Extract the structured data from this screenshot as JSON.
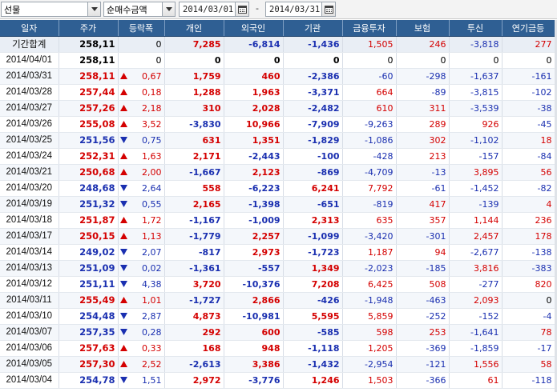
{
  "toolbar": {
    "market_select": "선물",
    "type_select": "순매수금액",
    "start_date": "2014/03/01",
    "separator": "-",
    "end_date": "2014/03/31"
  },
  "colors": {
    "up": "#d40000",
    "down": "#1a2fb0",
    "header_bg": "#2f5f93"
  },
  "table": {
    "headers": [
      "일자",
      "주가",
      "등락폭",
      "개인",
      "외국인",
      "기관",
      "금융투자",
      "보험",
      "투신",
      "연기금등"
    ],
    "summary": {
      "label": "기간합계",
      "price": "258,11",
      "change": "0",
      "individual": "7,285",
      "foreign": "-6,814",
      "institution": "-1,436",
      "fin_invest": "1,505",
      "insurance": "246",
      "trust": "-3,818",
      "pension": "277"
    },
    "rows": [
      {
        "date": "2014/04/01",
        "price": "258,11",
        "dir": "none",
        "change": "0",
        "individual": "0",
        "foreign": "0",
        "institution": "0",
        "fin_invest": "0",
        "insurance": "0",
        "trust": "0",
        "pension": "0"
      },
      {
        "date": "2014/03/31",
        "price": "258,11",
        "dir": "up",
        "change": "0,67",
        "individual": "1,759",
        "foreign": "460",
        "institution": "-2,386",
        "fin_invest": "-60",
        "insurance": "-298",
        "trust": "-1,637",
        "pension": "-161"
      },
      {
        "date": "2014/03/28",
        "price": "257,44",
        "dir": "up",
        "change": "0,18",
        "individual": "1,288",
        "foreign": "1,963",
        "institution": "-3,371",
        "fin_invest": "664",
        "insurance": "-89",
        "trust": "-3,815",
        "pension": "-102"
      },
      {
        "date": "2014/03/27",
        "price": "257,26",
        "dir": "up",
        "change": "2,18",
        "individual": "310",
        "foreign": "2,028",
        "institution": "-2,482",
        "fin_invest": "610",
        "insurance": "311",
        "trust": "-3,539",
        "pension": "-38"
      },
      {
        "date": "2014/03/26",
        "price": "255,08",
        "dir": "up",
        "change": "3,52",
        "individual": "-3,830",
        "foreign": "10,966",
        "institution": "-7,909",
        "fin_invest": "-9,263",
        "insurance": "289",
        "trust": "926",
        "pension": "-45"
      },
      {
        "date": "2014/03/25",
        "price": "251,56",
        "dir": "down",
        "change": "0,75",
        "individual": "631",
        "foreign": "1,351",
        "institution": "-1,829",
        "fin_invest": "-1,086",
        "insurance": "302",
        "trust": "-1,102",
        "pension": "18"
      },
      {
        "date": "2014/03/24",
        "price": "252,31",
        "dir": "up",
        "change": "1,63",
        "individual": "2,171",
        "foreign": "-2,443",
        "institution": "-100",
        "fin_invest": "-428",
        "insurance": "213",
        "trust": "-157",
        "pension": "-84"
      },
      {
        "date": "2014/03/21",
        "price": "250,68",
        "dir": "up",
        "change": "2,00",
        "individual": "-1,667",
        "foreign": "2,123",
        "institution": "-869",
        "fin_invest": "-4,709",
        "insurance": "-13",
        "trust": "3,895",
        "pension": "56"
      },
      {
        "date": "2014/03/20",
        "price": "248,68",
        "dir": "down",
        "change": "2,64",
        "individual": "558",
        "foreign": "-6,223",
        "institution": "6,241",
        "fin_invest": "7,792",
        "insurance": "-61",
        "trust": "-1,452",
        "pension": "-82"
      },
      {
        "date": "2014/03/19",
        "price": "251,32",
        "dir": "down",
        "change": "0,55",
        "individual": "2,165",
        "foreign": "-1,398",
        "institution": "-651",
        "fin_invest": "-819",
        "insurance": "417",
        "trust": "-139",
        "pension": "4"
      },
      {
        "date": "2014/03/18",
        "price": "251,87",
        "dir": "up",
        "change": "1,72",
        "individual": "-1,167",
        "foreign": "-1,009",
        "institution": "2,313",
        "fin_invest": "635",
        "insurance": "357",
        "trust": "1,144",
        "pension": "236"
      },
      {
        "date": "2014/03/17",
        "price": "250,15",
        "dir": "up",
        "change": "1,13",
        "individual": "-1,779",
        "foreign": "2,257",
        "institution": "-1,099",
        "fin_invest": "-3,420",
        "insurance": "-301",
        "trust": "2,457",
        "pension": "178"
      },
      {
        "date": "2014/03/14",
        "price": "249,02",
        "dir": "down",
        "change": "2,07",
        "individual": "-817",
        "foreign": "2,973",
        "institution": "-1,723",
        "fin_invest": "1,187",
        "insurance": "94",
        "trust": "-2,677",
        "pension": "-138"
      },
      {
        "date": "2014/03/13",
        "price": "251,09",
        "dir": "down",
        "change": "0,02",
        "individual": "-1,361",
        "foreign": "-557",
        "institution": "1,349",
        "fin_invest": "-2,023",
        "insurance": "-185",
        "trust": "3,816",
        "pension": "-383"
      },
      {
        "date": "2014/03/12",
        "price": "251,11",
        "dir": "down",
        "change": "4,38",
        "individual": "3,720",
        "foreign": "-10,376",
        "institution": "7,208",
        "fin_invest": "6,425",
        "insurance": "508",
        "trust": "-277",
        "pension": "820"
      },
      {
        "date": "2014/03/11",
        "price": "255,49",
        "dir": "up",
        "change": "1,01",
        "individual": "-1,727",
        "foreign": "2,866",
        "institution": "-426",
        "fin_invest": "-1,948",
        "insurance": "-463",
        "trust": "2,093",
        "pension": "0"
      },
      {
        "date": "2014/03/10",
        "price": "254,48",
        "dir": "down",
        "change": "2,87",
        "individual": "4,873",
        "foreign": "-10,981",
        "institution": "5,595",
        "fin_invest": "5,859",
        "insurance": "-252",
        "trust": "-152",
        "pension": "-4"
      },
      {
        "date": "2014/03/07",
        "price": "257,35",
        "dir": "down",
        "change": "0,28",
        "individual": "292",
        "foreign": "600",
        "institution": "-585",
        "fin_invest": "598",
        "insurance": "253",
        "trust": "-1,641",
        "pension": "78"
      },
      {
        "date": "2014/03/06",
        "price": "257,63",
        "dir": "up",
        "change": "0,33",
        "individual": "168",
        "foreign": "948",
        "institution": "-1,118",
        "fin_invest": "1,205",
        "insurance": "-369",
        "trust": "-1,859",
        "pension": "-17"
      },
      {
        "date": "2014/03/05",
        "price": "257,30",
        "dir": "up",
        "change": "2,52",
        "individual": "-2,613",
        "foreign": "3,386",
        "institution": "-1,432",
        "fin_invest": "-2,954",
        "insurance": "-121",
        "trust": "1,556",
        "pension": "58"
      },
      {
        "date": "2014/03/04",
        "price": "254,78",
        "dir": "down",
        "change": "1,51",
        "individual": "2,972",
        "foreign": "-3,776",
        "institution": "1,246",
        "fin_invest": "1,503",
        "insurance": "-366",
        "trust": "61",
        "pension": "-118"
      }
    ]
  }
}
